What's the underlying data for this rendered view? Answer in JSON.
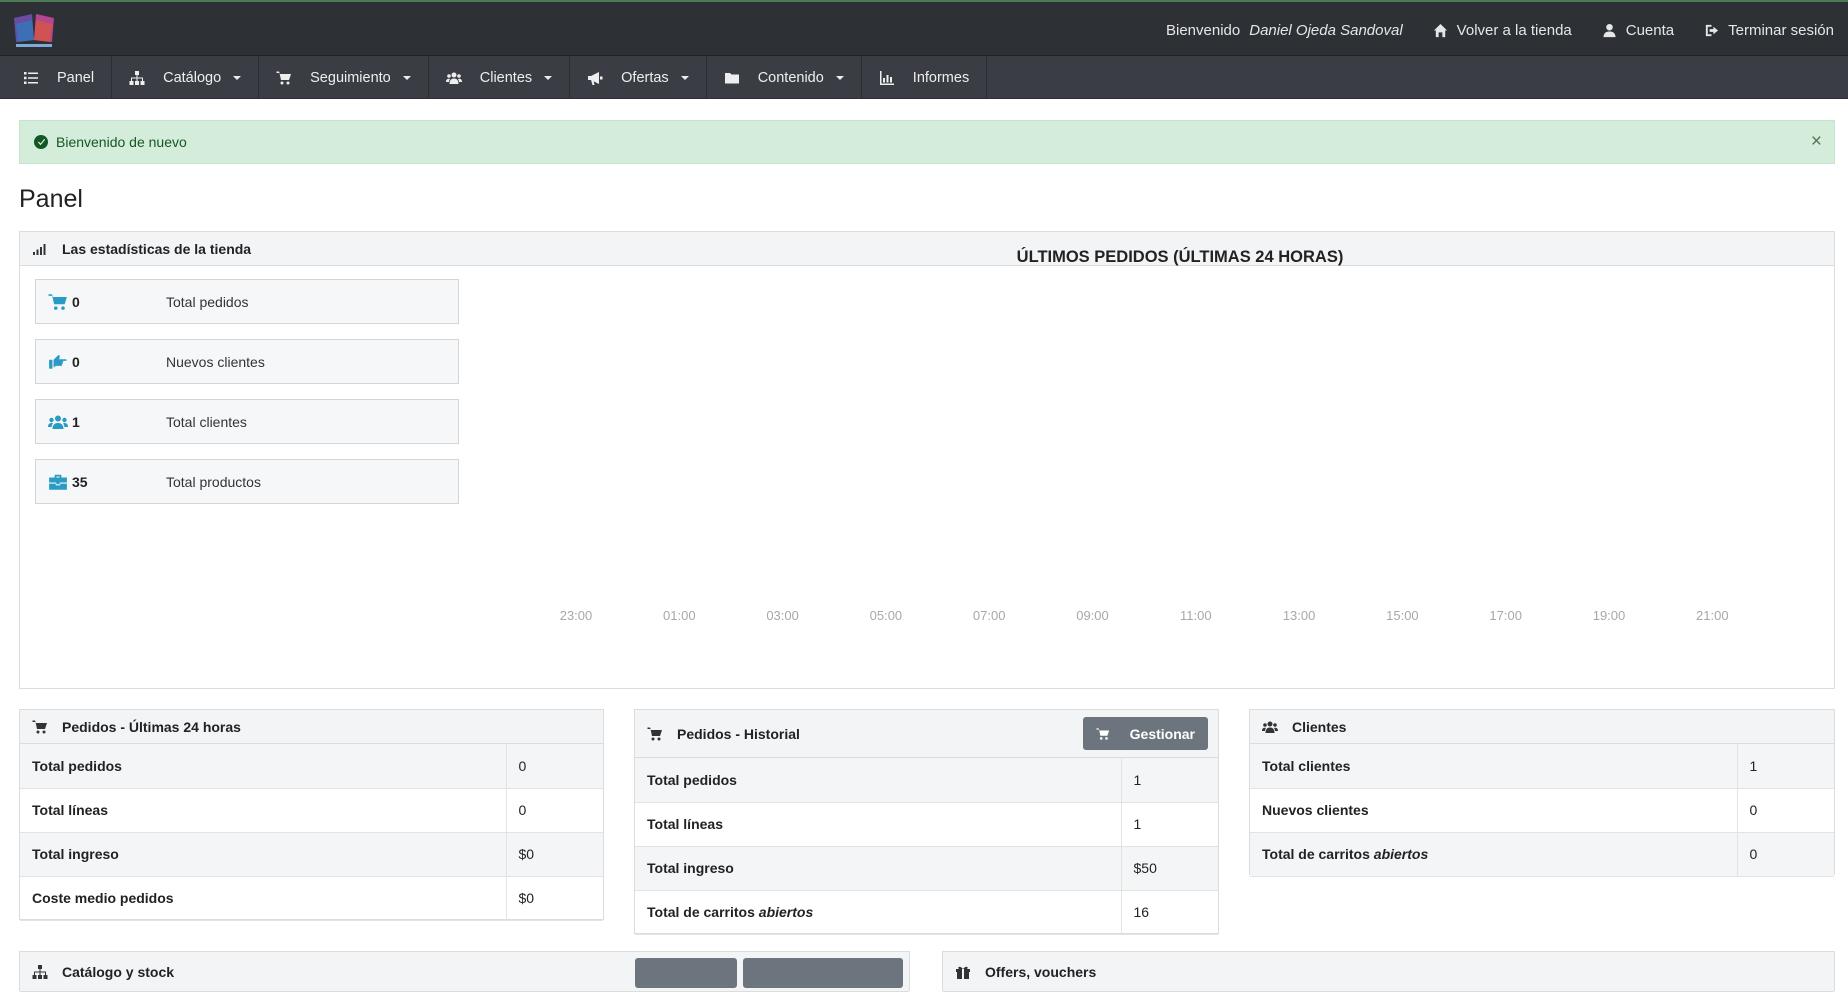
{
  "header": {
    "welcome_prefix": "Bienvenido",
    "user_name": "Daniel Ojeda Sandoval",
    "back_to_store": "Volver a la tienda",
    "account": "Cuenta",
    "logout": "Terminar sesión",
    "logo_icon": "book-logo-icon"
  },
  "nav": {
    "items": [
      {
        "label": "Panel",
        "icon": "list-icon"
      },
      {
        "label": "Catálogo",
        "icon": "sitemap-icon"
      },
      {
        "label": "Seguimiento",
        "icon": "cart-icon"
      },
      {
        "label": "Clientes",
        "icon": "users-icon"
      },
      {
        "label": "Ofertas",
        "icon": "megaphone-icon"
      },
      {
        "label": "Contenido",
        "icon": "folder-icon"
      },
      {
        "label": "Informes",
        "icon": "chart-icon"
      }
    ]
  },
  "alert": {
    "message": "Bienvenido de nuevo",
    "close": "×"
  },
  "page": {
    "title": "Panel"
  },
  "stats": {
    "title": "Las estadísticas de la tienda",
    "boxes": [
      {
        "value": "0",
        "label": "Total pedidos",
        "icon": "cart-icon"
      },
      {
        "value": "0",
        "label": "Nuevos clientes",
        "icon": "thumbs-right-icon"
      },
      {
        "value": "1",
        "label": "Total clientes",
        "icon": "users-icon"
      },
      {
        "value": "35",
        "label": "Total productos",
        "icon": "briefcase-icon"
      }
    ]
  },
  "chart_data": {
    "type": "line",
    "title": "ÚLTIMOS PEDIDOS (ÚLTIMAS 24 HORAS)",
    "categories": [
      "23:00",
      "01:00",
      "03:00",
      "05:00",
      "07:00",
      "09:00",
      "11:00",
      "13:00",
      "15:00",
      "17:00",
      "19:00",
      "21:00"
    ],
    "series": [],
    "grid": false
  },
  "orders24": {
    "title": "Pedidos - Últimas 24 horas",
    "rows": [
      {
        "key": "Total pedidos",
        "value": "0"
      },
      {
        "key": "Total líneas",
        "value": "0"
      },
      {
        "key": "Total ingreso",
        "value": "$0"
      },
      {
        "key": "Coste medio pedidos",
        "value": "$0"
      }
    ]
  },
  "history": {
    "title": "Pedidos - Historial",
    "manage": "Gestionar",
    "rows": [
      {
        "key": "Total pedidos",
        "value": "1"
      },
      {
        "key": "Total líneas",
        "value": "1"
      },
      {
        "key": "Total ingreso",
        "value": "$50"
      },
      {
        "key_prefix": "Total de carritos",
        "key_em": "abiertos",
        "value": "16"
      }
    ]
  },
  "customers": {
    "title": "Clientes",
    "rows": [
      {
        "key": "Total clientes",
        "value": "1"
      },
      {
        "key": "Nuevos clientes",
        "value": "0"
      },
      {
        "key_prefix": "Total de carritos",
        "key_em": "abiertos",
        "value": "0"
      }
    ]
  },
  "bottom": {
    "catalog_title": "Catálogo y stock",
    "offers_title": "Offers, vouchers"
  },
  "colors": {
    "topbar": "#2d3035",
    "nav": "#3a3e44",
    "accent": "#2a9cc3",
    "alert_bg": "#d4edda"
  }
}
